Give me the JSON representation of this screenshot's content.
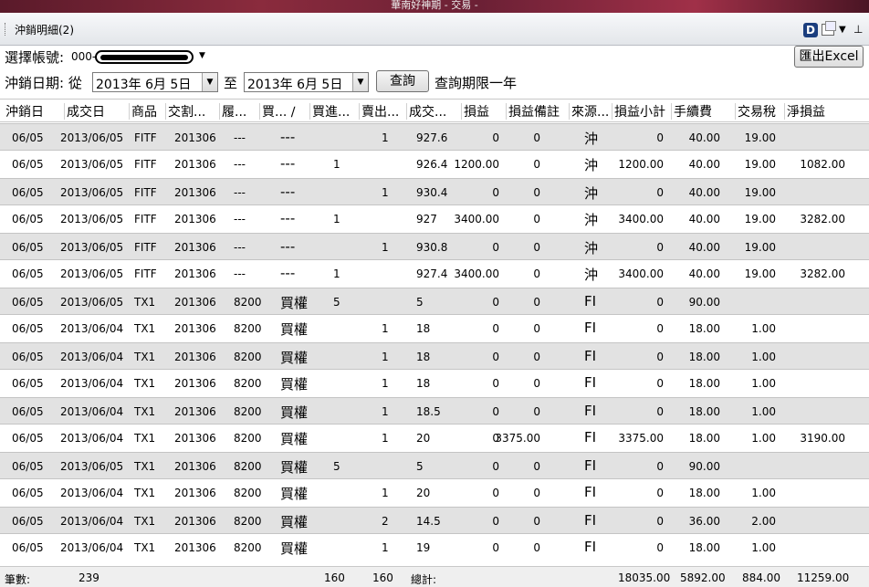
{
  "window": {
    "title": "華南好神期 - 交易 -"
  },
  "panel": {
    "title": "沖銷明細(2)",
    "d_badge": "D",
    "pin": "ㄗ"
  },
  "form": {
    "account_label": "選擇帳號:",
    "account_prefix": "000-",
    "date_label": "沖銷日期: 從",
    "from_date": "2013年  6月  5日",
    "to_label": "至",
    "to_date": "2013年  6月  5日",
    "query_button": "查詢",
    "query_limit": "查詢期限一年",
    "export_button": "匯出Excel"
  },
  "table": {
    "columns": [
      "沖銷日",
      "成交日",
      "商品",
      "交割...",
      "履...",
      "買... ∕",
      "買進...",
      "賣出...",
      "成交...",
      "損益",
      "損益備註",
      "來源...",
      "損益小計",
      "手續費",
      "交易稅",
      "淨損益"
    ],
    "rows": [
      [
        "06/05",
        "2013/06/05",
        "FITF",
        "201306",
        "---",
        "---",
        "",
        "1",
        "927.6",
        "0",
        "0",
        "沖",
        "0",
        "40.00",
        "19.00",
        ""
      ],
      [
        "06/05",
        "2013/06/05",
        "FITF",
        "201306",
        "---",
        "---",
        "1",
        "",
        "926.4",
        "1200.00",
        "0",
        "沖",
        "1200.00",
        "40.00",
        "19.00",
        "1082.00"
      ],
      [
        "06/05",
        "2013/06/05",
        "FITF",
        "201306",
        "---",
        "---",
        "",
        "1",
        "930.4",
        "0",
        "0",
        "沖",
        "0",
        "40.00",
        "19.00",
        ""
      ],
      [
        "06/05",
        "2013/06/05",
        "FITF",
        "201306",
        "---",
        "---",
        "1",
        "",
        "927",
        "3400.00",
        "0",
        "沖",
        "3400.00",
        "40.00",
        "19.00",
        "3282.00"
      ],
      [
        "06/05",
        "2013/06/05",
        "FITF",
        "201306",
        "---",
        "---",
        "",
        "1",
        "930.8",
        "0",
        "0",
        "沖",
        "0",
        "40.00",
        "19.00",
        ""
      ],
      [
        "06/05",
        "2013/06/05",
        "FITF",
        "201306",
        "---",
        "---",
        "1",
        "",
        "927.4",
        "3400.00",
        "0",
        "沖",
        "3400.00",
        "40.00",
        "19.00",
        "3282.00"
      ],
      [
        "06/05",
        "2013/06/05",
        "TX1",
        "201306",
        "8200",
        "買權",
        "5",
        "",
        "5",
        "0",
        "0",
        "FI",
        "0",
        "90.00",
        "",
        ""
      ],
      [
        "06/05",
        "2013/06/04",
        "TX1",
        "201306",
        "8200",
        "買權",
        "",
        "1",
        "18",
        "0",
        "0",
        "FI",
        "0",
        "18.00",
        "1.00",
        ""
      ],
      [
        "06/05",
        "2013/06/04",
        "TX1",
        "201306",
        "8200",
        "買權",
        "",
        "1",
        "18",
        "0",
        "0",
        "FI",
        "0",
        "18.00",
        "1.00",
        ""
      ],
      [
        "06/05",
        "2013/06/04",
        "TX1",
        "201306",
        "8200",
        "買權",
        "",
        "1",
        "18",
        "0",
        "0",
        "FI",
        "0",
        "18.00",
        "1.00",
        ""
      ],
      [
        "06/05",
        "2013/06/04",
        "TX1",
        "201306",
        "8200",
        "買權",
        "",
        "1",
        "18.5",
        "0",
        "0",
        "FI",
        "0",
        "18.00",
        "1.00",
        ""
      ],
      [
        "06/05",
        "2013/06/04",
        "TX1",
        "201306",
        "8200",
        "買權",
        "",
        "1",
        "20",
        "0",
        "3375.00",
        "FI",
        "3375.00",
        "18.00",
        "1.00",
        "3190.00"
      ],
      [
        "06/05",
        "2013/06/05",
        "TX1",
        "201306",
        "8200",
        "買權",
        "5",
        "",
        "5",
        "0",
        "0",
        "FI",
        "0",
        "90.00",
        "",
        ""
      ],
      [
        "06/05",
        "2013/06/04",
        "TX1",
        "201306",
        "8200",
        "買權",
        "",
        "1",
        "20",
        "0",
        "0",
        "FI",
        "0",
        "18.00",
        "1.00",
        ""
      ],
      [
        "06/05",
        "2013/06/04",
        "TX1",
        "201306",
        "8200",
        "買權",
        "",
        "2",
        "14.5",
        "0",
        "0",
        "FI",
        "0",
        "36.00",
        "2.00",
        ""
      ],
      [
        "06/05",
        "2013/06/04",
        "TX1",
        "201306",
        "8200",
        "買權",
        "",
        "1",
        "19",
        "0",
        "0",
        "FI",
        "0",
        "18.00",
        "1.00",
        ""
      ]
    ]
  },
  "footer": {
    "count_label": "筆數:",
    "count": "239",
    "buy_total": "160",
    "sell_total": "160",
    "total_label": "總計:",
    "pl_subtotal": "18035.00",
    "fee_total": "5892.00",
    "tax_total": "884.00",
    "net_total": "11259.00"
  }
}
